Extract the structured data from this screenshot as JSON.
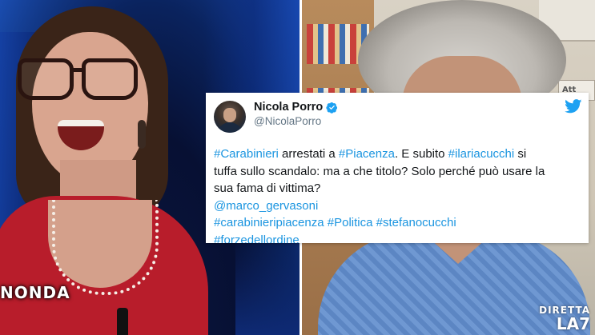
{
  "left_panel": {
    "show_logo": "NONDA"
  },
  "right_panel": {
    "side_sign": "Att",
    "tv_bug_line1": "DIRETTA",
    "tv_bug_line2": "LA7"
  },
  "tweet": {
    "display_name": "Nicola Porro",
    "handle": "@NicolaPorro",
    "verified_icon": "verified-badge-icon",
    "brand_icon": "twitter-bird-icon",
    "accent_color": "#1b95e0",
    "body": {
      "line1": {
        "h1": "#Carabinieri",
        "t1": " arrestati a ",
        "h2": "#Piacenza",
        "t2": ". E subito ",
        "h3": "#ilariacucchi",
        "t3": " si"
      },
      "line2": "tuffa sullo scandalo: ma a che titolo? Solo perché può usare la",
      "line3": "sua fama di vittima?",
      "line4_mention": "@marco_gervasoni",
      "line5": {
        "h1": "#carabinieripiacenza",
        "h2": "#Politica",
        "h3": "#stefanocucchi"
      },
      "line6_hashtag": "#forzedellordine"
    }
  }
}
